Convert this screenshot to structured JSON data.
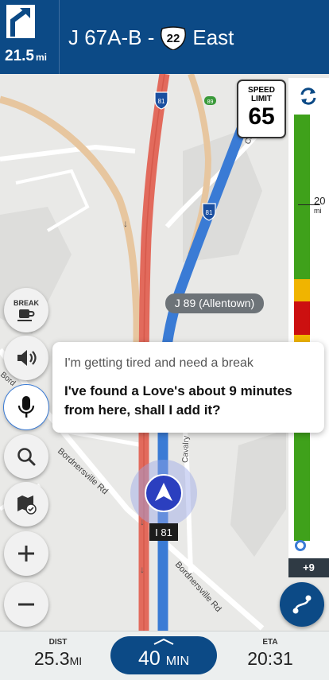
{
  "maneuver": {
    "distance": "21.5",
    "distance_unit": "mi",
    "icon": "bear-right-arrow-icon"
  },
  "road": {
    "prefix": "J 67A-B -",
    "shield_number": "22",
    "direction": "East"
  },
  "speed_limit": {
    "label_line1": "SPEED",
    "label_line2": "LIMIT",
    "value": "65"
  },
  "traffic_bar": {
    "distance_marker": "20",
    "distance_unit": "mi",
    "more_label": "+9",
    "refresh_icon": "refresh-icon"
  },
  "map": {
    "interstate_81_a": "81",
    "interstate_81_b": "81",
    "exit_89": "89",
    "exit_label": "J 89 (Allentown)",
    "current_road_badge": "I 81",
    "street_1": "Bordnersville Rd",
    "street_2": "Bordnersville Rd",
    "street_3": "Cavalry",
    "street_4": "Ca",
    "street_5": "Bord"
  },
  "side_buttons": {
    "break_label": "BREAK"
  },
  "assistant": {
    "user_query": "I'm getting tired and need a break",
    "response": "I've found a Love's about 9 minutes from here, shall I add it?"
  },
  "trip": {
    "dist_caption": "DIST",
    "dist_value": "25.3",
    "dist_unit": "MI",
    "time_value": "40",
    "time_unit": "MIN",
    "eta_caption": "ETA",
    "eta_value": "20:31"
  },
  "colors": {
    "header": "#0c4a86",
    "traffic_green": "#3fa11b",
    "traffic_yellow": "#f0b400",
    "traffic_red": "#cc1010",
    "route_blue": "#3a7bd5"
  }
}
